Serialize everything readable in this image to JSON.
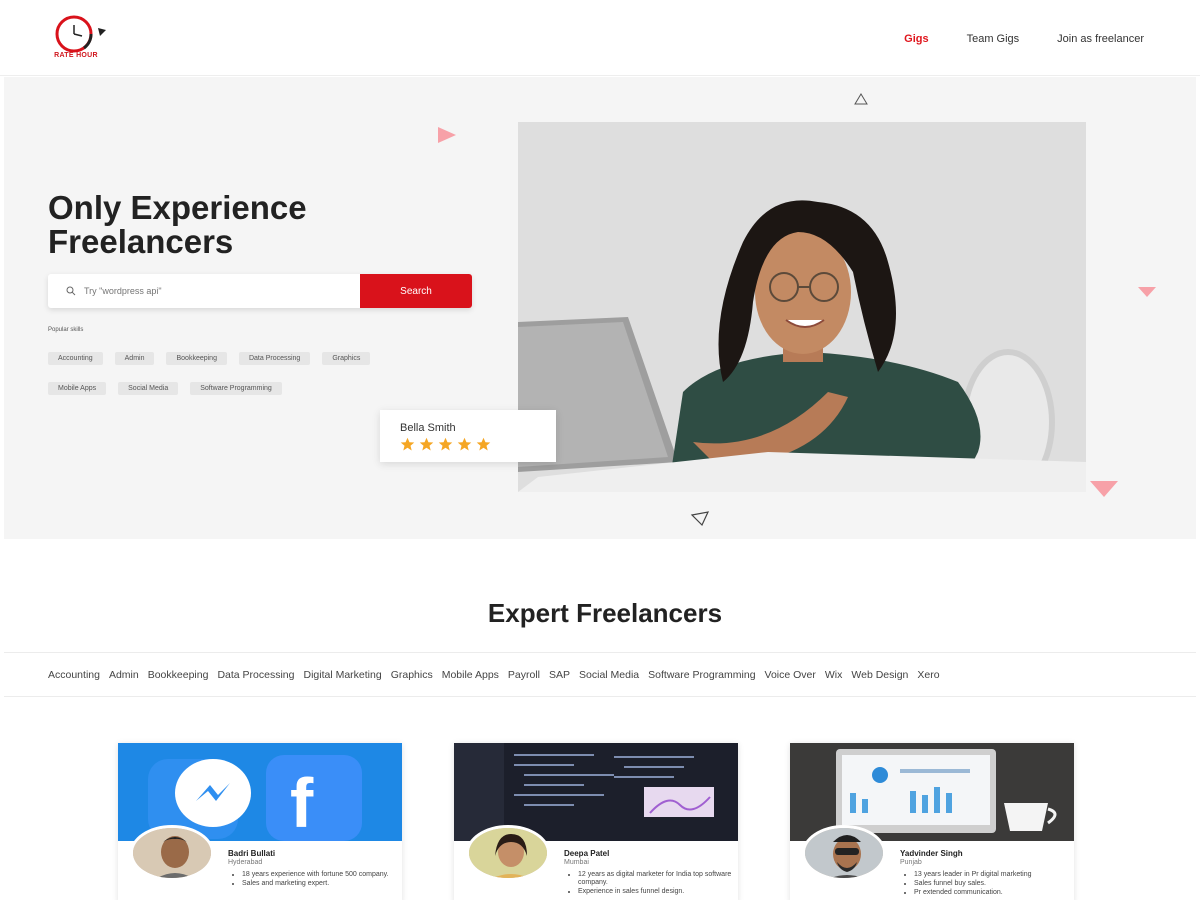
{
  "brand": {
    "name": "RATE HOUR",
    "accent": "#d9121b"
  },
  "nav": {
    "items": [
      {
        "label": "Gigs",
        "active": true
      },
      {
        "label": "Team Gigs",
        "active": false
      },
      {
        "label": "Join as freelancer",
        "active": false
      }
    ]
  },
  "hero": {
    "title_line1": "Only Experience",
    "title_line2": "Freelancers",
    "search_placeholder": "Try \"wordpress api\"",
    "search_button": "Search",
    "popular_label": "Popular skills",
    "tags": [
      "Accounting",
      "Admin",
      "Bookkeeping",
      "Data Processing",
      "Graphics",
      "Mobile Apps",
      "Social Media",
      "Software Programming"
    ],
    "review": {
      "name": "Bella Smith",
      "rating": 5
    }
  },
  "experts": {
    "title": "Expert Freelancers",
    "categories": [
      "Accounting",
      "Admin",
      "Bookkeeping",
      "Data Processing",
      "Digital Marketing",
      "Graphics",
      "Mobile Apps",
      "Payroll",
      "SAP",
      "Social Media",
      "Software Programming",
      "Voice Over",
      "Wix",
      "Web Design",
      "Xero"
    ],
    "cards": [
      {
        "name": "Badri Bullati",
        "location": "Hyderabad",
        "bullets": [
          "18 years experience with fortune 500 company.",
          "Sales and marketing expert."
        ]
      },
      {
        "name": "Deepa Patel",
        "location": "Mumbai",
        "bullets": [
          "12 years as digital marketer for India top software company.",
          "Experience in sales funnel design."
        ]
      },
      {
        "name": "Yadvinder Singh",
        "location": "Punjab",
        "bullets": [
          "13 years leader in Pr digital marketing",
          "Sales funnel buy sales.",
          "Pr extended communication."
        ]
      }
    ]
  }
}
